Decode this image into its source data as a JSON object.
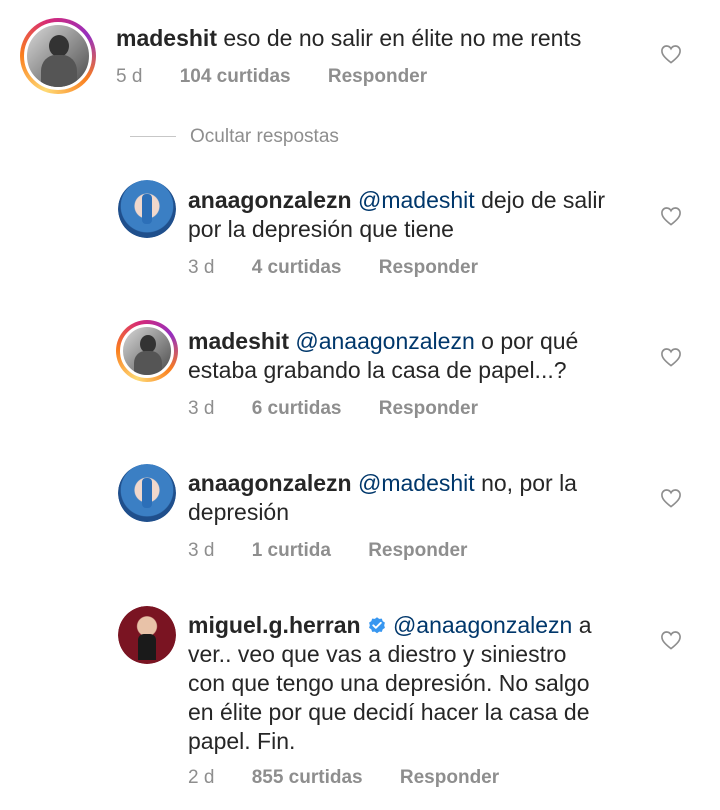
{
  "hide_replies_label": "Ocultar respostas",
  "reply_label": "Responder",
  "comments": [
    {
      "username": "madeshit",
      "mention": "",
      "lines": [
        "eso de no salir en élite no me rents"
      ],
      "time": "5 d",
      "likes": "104 curtidas",
      "avatar": "profile-photo-grayscale"
    },
    {
      "username": "anaagonzalezn",
      "mention": "@madeshit",
      "lines": [
        "dejo de salir",
        "por la depresión que tiene"
      ],
      "time": "3 d",
      "likes": "4 curtidas",
      "avatar": "profile-photo-blue-hair"
    },
    {
      "username": "madeshit",
      "mention": "@anaagonzalezn",
      "lines": [
        "o por qué",
        "estaba grabando la casa de papel...?"
      ],
      "time": "3 d",
      "likes": "6 curtidas",
      "avatar": "profile-photo-grayscale"
    },
    {
      "username": "anaagonzalezn",
      "mention": "@madeshit",
      "lines": [
        "no, por la",
        "depresión"
      ],
      "time": "3 d",
      "likes": "1 curtida",
      "avatar": "profile-photo-blue-hair"
    },
    {
      "username": "miguel.g.herran",
      "verified": true,
      "mention": "@anaagonzalezn",
      "lines": [
        "a",
        "ver.. veo que vas a diestro y siniestro",
        "con que tengo una depresión. No salgo",
        "en élite por que decidí hacer la casa de",
        "papel. Fin."
      ],
      "time": "2 d",
      "likes": "855 curtidas",
      "avatar": "profile-photo-red-background"
    }
  ],
  "colors": {
    "text": "#262626",
    "meta": "#8e8e8e",
    "mention": "#00376b",
    "verified": "#3897f0"
  }
}
